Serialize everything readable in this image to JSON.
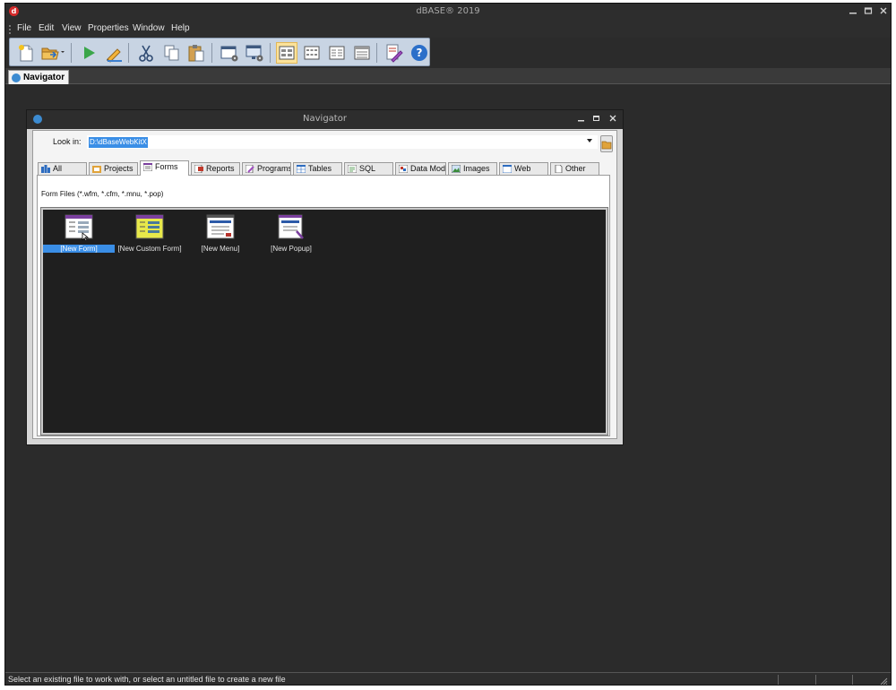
{
  "app": {
    "title": "dBASE® 2019",
    "icon_letter": "d",
    "window_controls": [
      "minimize-icon",
      "maximize-icon",
      "close-icon"
    ]
  },
  "menubar": {
    "items": [
      {
        "label": "File"
      },
      {
        "label": "Edit"
      },
      {
        "label": "View"
      },
      {
        "label": "Properties"
      },
      {
        "label": "Window"
      },
      {
        "label": "Help"
      }
    ]
  },
  "toolbar": {
    "buttons": [
      {
        "icon": "new-file-icon"
      },
      {
        "icon": "open-folder-icon"
      },
      {
        "icon": "run-icon"
      },
      {
        "icon": "design-icon"
      },
      {
        "icon": "cut-icon"
      },
      {
        "icon": "copy-icon"
      },
      {
        "icon": "paste-icon"
      },
      {
        "icon": "properties-window-icon"
      },
      {
        "icon": "properties-settings-icon"
      },
      {
        "icon": "view-large-icons-icon",
        "active": true
      },
      {
        "icon": "view-small-icons-icon"
      },
      {
        "icon": "view-list-icon"
      },
      {
        "icon": "view-details-icon"
      },
      {
        "icon": "edit-records-icon"
      },
      {
        "icon": "help-icon"
      }
    ]
  },
  "doc_tabs": [
    {
      "label": "Navigator"
    }
  ],
  "navigator": {
    "title": "Navigator",
    "look_in_label": "Look in:",
    "look_in_value": "D:\\dBaseWebKitX",
    "tabs": [
      {
        "label": "All"
      },
      {
        "label": "Projects"
      },
      {
        "label": "Forms",
        "selected": true
      },
      {
        "label": "Reports"
      },
      {
        "label": "Programs"
      },
      {
        "label": "Tables"
      },
      {
        "label": "SQL"
      },
      {
        "label": "Data Modu"
      },
      {
        "label": "Images"
      },
      {
        "label": "Web"
      },
      {
        "label": "Other"
      }
    ],
    "file_types": "Form Files (*.wfm, *.cfm, *.mnu, *.pop)",
    "files": [
      {
        "label": "[New Form]",
        "selected": true,
        "icon": "new-form-icon"
      },
      {
        "label": "[New Custom Form]",
        "icon": "new-custom-form-icon"
      },
      {
        "label": "[New Menu]",
        "icon": "new-menu-icon"
      },
      {
        "label": "[New Popup]",
        "icon": "new-popup-icon"
      }
    ]
  },
  "status": {
    "text": "Select an existing file to work with, or select an untitled file to create a new file"
  },
  "colors": {
    "workspace": "#2b2b2b",
    "selection": "#3a8ee6",
    "toolbar": "#c8d4e3",
    "form_purple": "#7b3f9e"
  }
}
